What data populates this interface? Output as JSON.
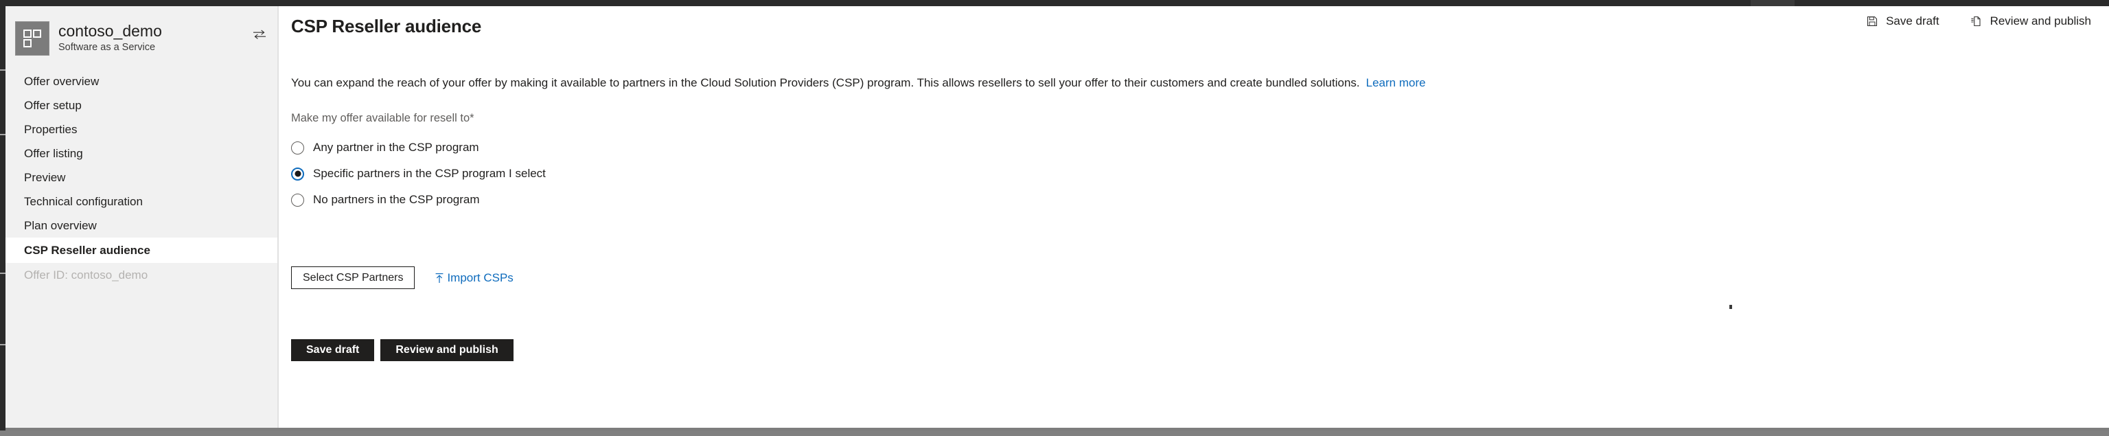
{
  "window": {
    "chrome_top_color": "#2b2b2b",
    "chrome_bottom_color": "#808080"
  },
  "sidebar": {
    "offer": {
      "logo_icon": "tiles-grid-icon",
      "name": "contoso_demo",
      "type": "Software as a Service",
      "swap_icon": "swap-offer-icon"
    },
    "items": [
      {
        "label": "Offer overview",
        "selected": false,
        "muted": false
      },
      {
        "label": "Offer setup",
        "selected": false,
        "muted": false
      },
      {
        "label": "Properties",
        "selected": false,
        "muted": false
      },
      {
        "label": "Offer listing",
        "selected": false,
        "muted": false
      },
      {
        "label": "Preview",
        "selected": false,
        "muted": false
      },
      {
        "label": "Technical configuration",
        "selected": false,
        "muted": false
      },
      {
        "label": "Plan overview",
        "selected": false,
        "muted": false
      },
      {
        "label": "CSP Reseller audience",
        "selected": true,
        "muted": false
      },
      {
        "label": "Offer ID: contoso_demo",
        "selected": false,
        "muted": true
      }
    ]
  },
  "command_bar": {
    "save_draft": {
      "label": "Save draft",
      "icon": "save-floppy-icon"
    },
    "review_publish": {
      "label": "Review and publish",
      "icon": "publish-document-icon"
    }
  },
  "main": {
    "title": "CSP Reseller audience",
    "description": "You can expand the reach of your offer by making it available to partners in the Cloud Solution Providers (CSP) program. This allows resellers to sell your offer to their customers and create bundled solutions.",
    "learn_more": "Learn more",
    "field_label": "Make my offer available for resell to*",
    "radio_options": [
      {
        "label": "Any partner in the CSP program",
        "checked": false
      },
      {
        "label": "Specific partners in the CSP program I select",
        "checked": true
      },
      {
        "label": "No partners in the CSP program",
        "checked": false
      }
    ],
    "select_partners_button": "Select CSP Partners",
    "import_csps": {
      "label": "Import CSPs",
      "icon": "upload-arrow-icon"
    },
    "footer_buttons": [
      {
        "label": "Save draft"
      },
      {
        "label": "Review and publish"
      }
    ]
  },
  "colors": {
    "accent_link": "#0f6cbd",
    "primary_button_bg": "#201f1e",
    "sidebar_bg": "#f1f1f1",
    "muted_text": "#605e5c"
  }
}
